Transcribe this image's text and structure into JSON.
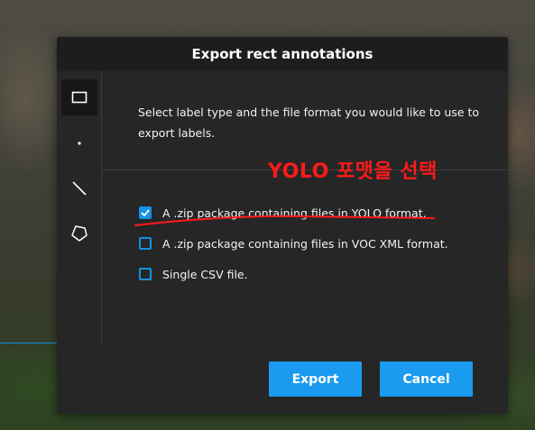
{
  "dialog": {
    "title": "Export rect annotations",
    "description": "Select label type and the file format you would like to use to export labels."
  },
  "tools": [
    {
      "icon": "rectangle-icon",
      "active": true
    },
    {
      "icon": "point-icon",
      "active": false
    },
    {
      "icon": "line-icon",
      "active": false
    },
    {
      "icon": "polygon-icon",
      "active": false
    }
  ],
  "options": [
    {
      "label": "A .zip package containing files in YOLO format.",
      "checked": true
    },
    {
      "label": "A .zip package containing files in VOC XML format.",
      "checked": false
    },
    {
      "label": "Single CSV file.",
      "checked": false
    }
  ],
  "buttons": {
    "export_label": "Export",
    "cancel_label": "Cancel"
  },
  "annotation": {
    "text": "YOLO 포맷을 선택",
    "color": "#ff1a1a"
  },
  "colors": {
    "accent": "#1a9bef",
    "dialog_bg": "#262626",
    "header_bg": "#1d1d1d"
  }
}
